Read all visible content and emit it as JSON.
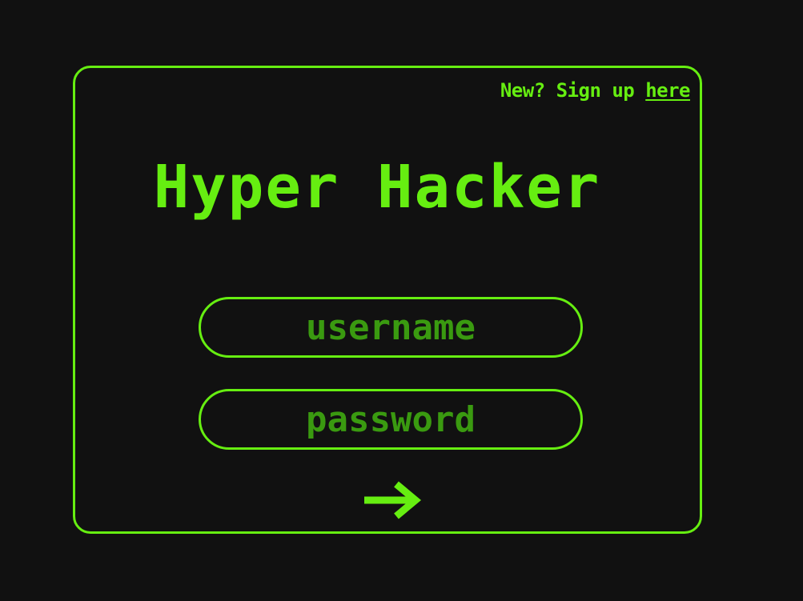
{
  "card": {
    "signup_prefix": "New? Sign up ",
    "signup_link": "here",
    "title": "Hyper Hacker"
  },
  "form": {
    "username_placeholder": "username",
    "password_placeholder": "password",
    "submit_icon": "arrow-right-icon"
  },
  "colors": {
    "background": "#111111",
    "accent": "#66ee11",
    "placeholder": "#3a9a10"
  }
}
